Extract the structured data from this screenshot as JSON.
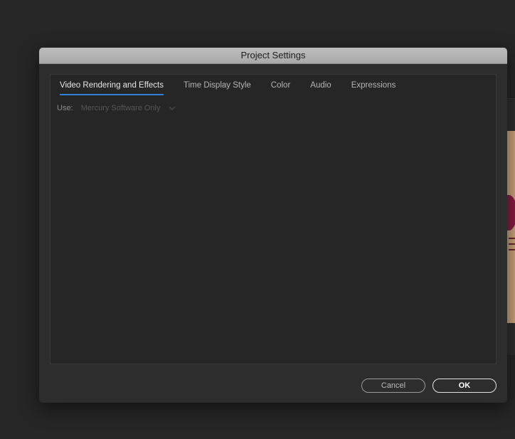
{
  "dialog": {
    "title": "Project Settings"
  },
  "tabs": [
    {
      "label": "Video Rendering and Effects",
      "active": true
    },
    {
      "label": "Time Display Style",
      "active": false
    },
    {
      "label": "Color",
      "active": false
    },
    {
      "label": "Audio",
      "active": false
    },
    {
      "label": "Expressions",
      "active": false
    }
  ],
  "video_rendering": {
    "use_label": "Use:",
    "renderer_value": "Mercury Software Only",
    "renderer_enabled": false
  },
  "buttons": {
    "cancel_label": "Cancel",
    "ok_label": "OK"
  },
  "colors": {
    "tab_underline": "#2f80d6",
    "dialog_bg": "#2d2d2d",
    "titlebar": "#b3b3b3"
  },
  "icons": {
    "dropdown": "chevron-down-icon"
  }
}
